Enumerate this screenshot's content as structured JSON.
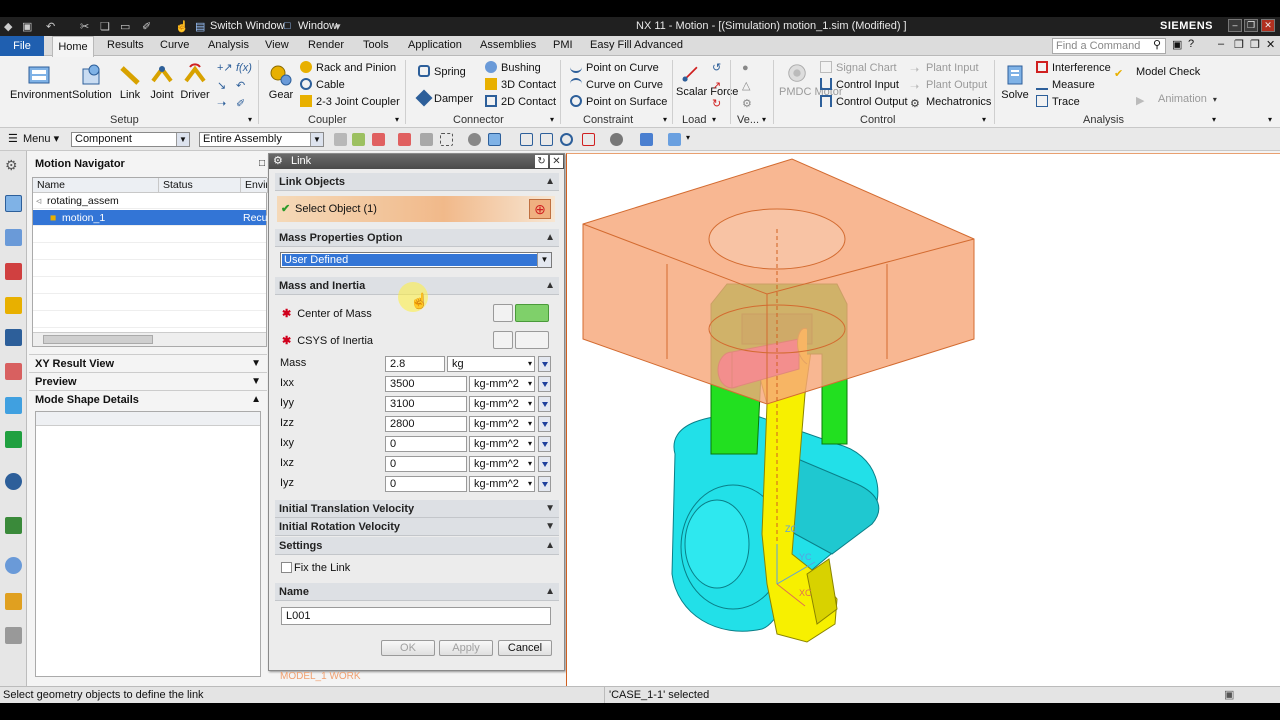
{
  "window": {
    "title": "NX 11 - Motion - [(Simulation) motion_1.sim (Modified) ]",
    "brand": "SIEMENS",
    "switch_window": "Switch Window",
    "window_menu": "Window"
  },
  "tabs": [
    "File",
    "Home",
    "Results",
    "Curve",
    "Analysis",
    "View",
    "Render",
    "Tools",
    "Application",
    "Assemblies",
    "PMI",
    "Easy Fill Advanced"
  ],
  "find_command_placeholder": "Find a Command",
  "ribbon": {
    "setup": {
      "label": "Setup",
      "buttons": [
        "Environment",
        "Solution",
        "Link",
        "Joint",
        "Driver"
      ]
    },
    "coupler": {
      "label": "Coupler",
      "gear": "Gear",
      "items": [
        "Rack and Pinion",
        "Cable",
        "2-3 Joint Coupler"
      ]
    },
    "connector": {
      "label": "Connector",
      "items": [
        "Spring",
        "Damper",
        "Bushing",
        "3D Contact",
        "2D Contact"
      ]
    },
    "constraint": {
      "label": "Constraint",
      "items": [
        "Point on Curve",
        "Curve on Curve",
        "Point on Surface"
      ]
    },
    "load": {
      "label": "Load",
      "scalar_force": "Scalar Force"
    },
    "ve": {
      "label": "Ve..."
    },
    "control": {
      "label": "Control",
      "pmdc": "PMDC Motor",
      "items": [
        "Signal Chart",
        "Control Input",
        "Control Output",
        "Plant Input",
        "Plant Output",
        "Mechatronics"
      ]
    },
    "analysis": {
      "label": "Analysis",
      "solve": "Solve",
      "items": [
        "Interference",
        "Measure",
        "Trace",
        "Model Check",
        "Animation"
      ]
    }
  },
  "toolbar": {
    "menu": "Menu",
    "filter": "Component",
    "scope": "Entire Assembly"
  },
  "navigator": {
    "title": "Motion Navigator",
    "columns": [
      "Name",
      "Status",
      "Envir"
    ],
    "rows": [
      {
        "name": "rotating_assem",
        "status": "",
        "env": ""
      },
      {
        "name": "motion_1",
        "status": "",
        "env": "Recu"
      }
    ],
    "panels": [
      "XY Result View",
      "Preview",
      "Mode Shape Details"
    ]
  },
  "dialog": {
    "title": "Link",
    "link_objects": "Link Objects",
    "select_object": "Select Object (1)",
    "mass_properties_option": "Mass Properties Option",
    "mass_option_value": "User Defined",
    "mass_and_inertia": "Mass and Inertia",
    "center_of_mass": "Center of Mass",
    "csys_of_inertia": "CSYS of Inertia",
    "fields": [
      {
        "label": "Mass",
        "value": "2.8",
        "unit": "kg"
      },
      {
        "label": "Ixx",
        "value": "3500",
        "unit": "kg-mm^2"
      },
      {
        "label": "Iyy",
        "value": "3100",
        "unit": "kg-mm^2"
      },
      {
        "label": "Izz",
        "value": "2800",
        "unit": "kg-mm^2"
      },
      {
        "label": "Ixy",
        "value": "0",
        "unit": "kg-mm^2"
      },
      {
        "label": "Ixz",
        "value": "0",
        "unit": "kg-mm^2"
      },
      {
        "label": "Iyz",
        "value": "0",
        "unit": "kg-mm^2"
      }
    ],
    "initial_translation_velocity": "Initial Translation Velocity",
    "initial_rotation_velocity": "Initial Rotation Velocity",
    "settings": "Settings",
    "fix_the_link": "Fix the Link",
    "name_section": "Name",
    "name_value": "L001",
    "ok": "OK",
    "apply": "Apply",
    "cancel": "Cancel"
  },
  "viewport": {
    "work_label": "MODEL_1 WORK",
    "axis_labels": [
      "ZC",
      "YC",
      "XC"
    ]
  },
  "status": {
    "left": "Select geometry objects to define the link",
    "right": "'CASE_1-1' selected"
  },
  "colors": {
    "file_tab": "#1f5fb0",
    "block": "#f6a77a",
    "cyan_part": "#22e0e8",
    "yellow_part": "#f7f000",
    "green_part": "#22e020",
    "magenta_pin": "#e020e0",
    "selection": "#3375d6"
  }
}
